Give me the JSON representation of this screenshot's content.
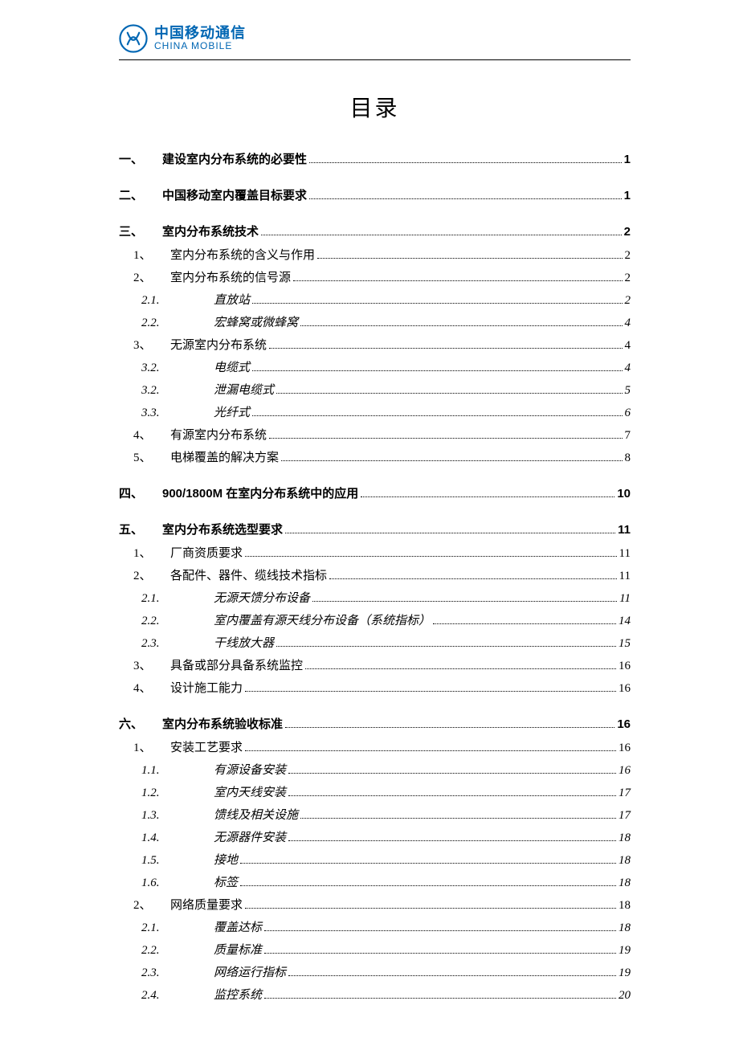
{
  "brand": {
    "cn": "中国移动通信",
    "en": "CHINA MOBILE"
  },
  "title": "目录",
  "toc": [
    {
      "level": 1,
      "num": "一、",
      "label": "建设室内分布系统的必要性",
      "page": "1"
    },
    {
      "level": 1,
      "num": "二、",
      "label": "中国移动室内覆盖目标要求",
      "page": "1"
    },
    {
      "level": 1,
      "num": "三、",
      "label": "室内分布系统技术",
      "page": "2"
    },
    {
      "level": 2,
      "num": "1、",
      "label": "室内分布系统的含义与作用",
      "page": "2"
    },
    {
      "level": 2,
      "num": "2、",
      "label": "室内分布系统的信号源",
      "page": "2"
    },
    {
      "level": 3,
      "num": "2.1.",
      "label": "直放站",
      "page": "2"
    },
    {
      "level": 3,
      "num": "2.2.",
      "label": "宏蜂窝或微蜂窝",
      "page": "4"
    },
    {
      "level": 2,
      "num": "3、",
      "label": "无源室内分布系统",
      "page": "4"
    },
    {
      "level": 3,
      "num": "3.2.",
      "label": "电缆式",
      "page": "4"
    },
    {
      "level": 3,
      "num": "3.2.",
      "label": "泄漏电缆式",
      "page": "5"
    },
    {
      "level": 3,
      "num": "3.3.",
      "label": "光纤式",
      "page": "6"
    },
    {
      "level": 2,
      "num": "4、",
      "label": "有源室内分布系统",
      "page": "7"
    },
    {
      "level": 2,
      "num": "5、",
      "label": "电梯覆盖的解决方案",
      "page": "8"
    },
    {
      "level": 1,
      "num": "四、",
      "label": "900/1800M 在室内分布系统中的应用",
      "page": "10"
    },
    {
      "level": 1,
      "num": "五、",
      "label": "室内分布系统选型要求",
      "page": "11"
    },
    {
      "level": 2,
      "num": "1、",
      "label": "厂商资质要求",
      "page": "11"
    },
    {
      "level": 2,
      "num": "2、",
      "label": "各配件、器件、缆线技术指标",
      "page": "11"
    },
    {
      "level": 3,
      "num": "2.1.",
      "label": "无源天馈分布设备",
      "page": "11"
    },
    {
      "level": 3,
      "num": "2.2.",
      "label": "室内覆盖有源天线分布设备（系统指标）",
      "page": "14"
    },
    {
      "level": 3,
      "num": "2.3.",
      "label": "干线放大器",
      "page": "15"
    },
    {
      "level": 2,
      "num": "3、",
      "label": "具备或部分具备系统监控",
      "page": "16"
    },
    {
      "level": 2,
      "num": "4、",
      "label": "设计施工能力",
      "page": "16"
    },
    {
      "level": 1,
      "num": "六、",
      "label": "室内分布系统验收标准",
      "page": "16"
    },
    {
      "level": 2,
      "num": "1、",
      "label": "安装工艺要求",
      "page": "16"
    },
    {
      "level": 3,
      "num": "1.1.",
      "label": "有源设备安装",
      "page": "16"
    },
    {
      "level": 3,
      "num": "1.2.",
      "label": "室内天线安装",
      "page": "17"
    },
    {
      "level": 3,
      "num": "1.3.",
      "label": "馈线及相关设施",
      "page": "17"
    },
    {
      "level": 3,
      "num": "1.4.",
      "label": "无源器件安装",
      "page": "18"
    },
    {
      "level": 3,
      "num": "1.5.",
      "label": "接地",
      "page": "18"
    },
    {
      "level": 3,
      "num": "1.6.",
      "label": "标签",
      "page": "18"
    },
    {
      "level": 2,
      "num": "2、",
      "label": "网络质量要求",
      "page": "18"
    },
    {
      "level": 3,
      "num": "2.1.",
      "label": "覆盖达标",
      "page": "18"
    },
    {
      "level": 3,
      "num": "2.2.",
      "label": "质量标准",
      "page": "19"
    },
    {
      "level": 3,
      "num": "2.3.",
      "label": "网络运行指标",
      "page": "19"
    },
    {
      "level": 3,
      "num": "2.4.",
      "label": "监控系统",
      "page": "20"
    }
  ]
}
